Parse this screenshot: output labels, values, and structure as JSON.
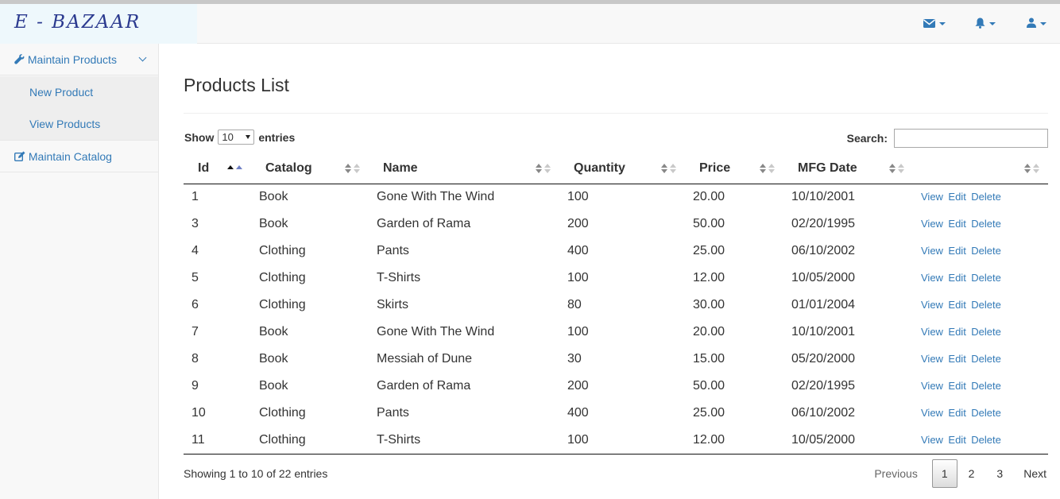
{
  "brand": "E - BAZAAR",
  "navbar": {
    "icons": [
      "envelope-icon",
      "bell-icon",
      "user-icon"
    ],
    "accent": "#337ab7"
  },
  "sidebar": {
    "maintain_products": "Maintain Products",
    "new_product": "New Product",
    "view_products": "View Products",
    "maintain_catalog": "Maintain Catalog"
  },
  "page": {
    "title": "Products List",
    "show_label": "Show",
    "entries_label": "entries",
    "page_length": "10",
    "search_label": "Search:",
    "search_value": "",
    "info": "Showing 1 to 10 of 22 entries"
  },
  "table": {
    "columns": [
      "Id",
      "Catalog",
      "Name",
      "Quantity",
      "Price",
      "MFG Date",
      ""
    ],
    "sorted_column": "Id",
    "sort_direction": "ascending",
    "rows": [
      {
        "id": "1",
        "catalog": "Book",
        "name": "Gone With The Wind",
        "quantity": "100",
        "price": "20.00",
        "mfg": "10/10/2001"
      },
      {
        "id": "3",
        "catalog": "Book",
        "name": "Garden of Rama",
        "quantity": "200",
        "price": "50.00",
        "mfg": "02/20/1995"
      },
      {
        "id": "4",
        "catalog": "Clothing",
        "name": "Pants",
        "quantity": "400",
        "price": "25.00",
        "mfg": "06/10/2002"
      },
      {
        "id": "5",
        "catalog": "Clothing",
        "name": "T-Shirts",
        "quantity": "100",
        "price": "12.00",
        "mfg": "10/05/2000"
      },
      {
        "id": "6",
        "catalog": "Clothing",
        "name": "Skirts",
        "quantity": "80",
        "price": "30.00",
        "mfg": "01/01/2004"
      },
      {
        "id": "7",
        "catalog": "Book",
        "name": "Gone With The Wind",
        "quantity": "100",
        "price": "20.00",
        "mfg": "10/10/2001"
      },
      {
        "id": "8",
        "catalog": "Book",
        "name": "Messiah of Dune",
        "quantity": "30",
        "price": "15.00",
        "mfg": "05/20/2000"
      },
      {
        "id": "9",
        "catalog": "Book",
        "name": "Garden of Rama",
        "quantity": "200",
        "price": "50.00",
        "mfg": "02/20/1995"
      },
      {
        "id": "10",
        "catalog": "Clothing",
        "name": "Pants",
        "quantity": "400",
        "price": "25.00",
        "mfg": "06/10/2002"
      },
      {
        "id": "11",
        "catalog": "Clothing",
        "name": "T-Shirts",
        "quantity": "100",
        "price": "12.00",
        "mfg": "10/05/2000"
      }
    ],
    "actions": {
      "view": "View",
      "edit": "Edit",
      "delete": "Delete"
    }
  },
  "pagination": {
    "previous": "Previous",
    "pages": [
      "1",
      "2",
      "3"
    ],
    "current": "1",
    "next": "Next"
  }
}
